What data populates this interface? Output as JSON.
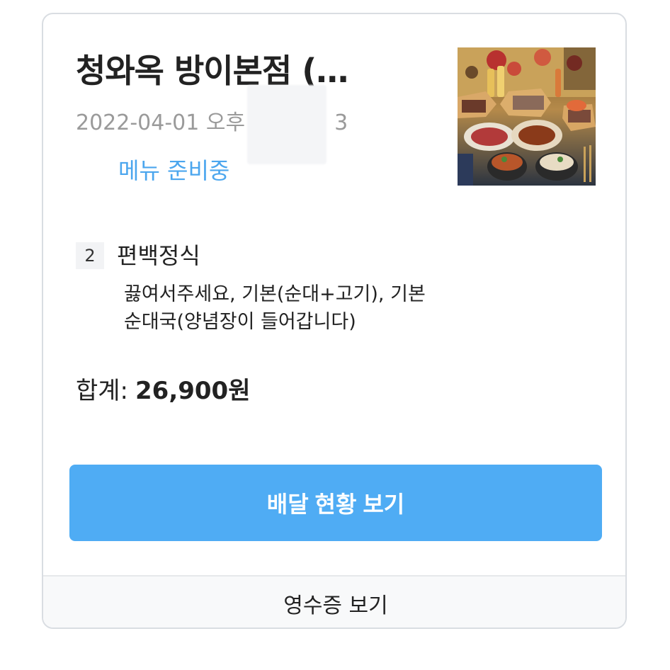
{
  "order": {
    "store_name": "청와옥 방이본점 (…",
    "date_prefix": "2022-04-01 오후",
    "date_suffix": "3",
    "status": "메뉴 준비중",
    "thumbnail": "korean-food-table-photo"
  },
  "item": {
    "quantity": "2",
    "name": "편백정식",
    "options_line1": "끓여서주세요, 기본(순대+고기), 기본",
    "options_line2": "순대국(양념장이 들어갑니다)"
  },
  "total": {
    "label": "합계:",
    "amount": "26,900원"
  },
  "actions": {
    "track_delivery": "배달 현황 보기",
    "view_receipt": "영수증 보기"
  },
  "colors": {
    "accent": "#4facf4",
    "status": "#4ba6ee",
    "muted": "#9a9a9a"
  }
}
